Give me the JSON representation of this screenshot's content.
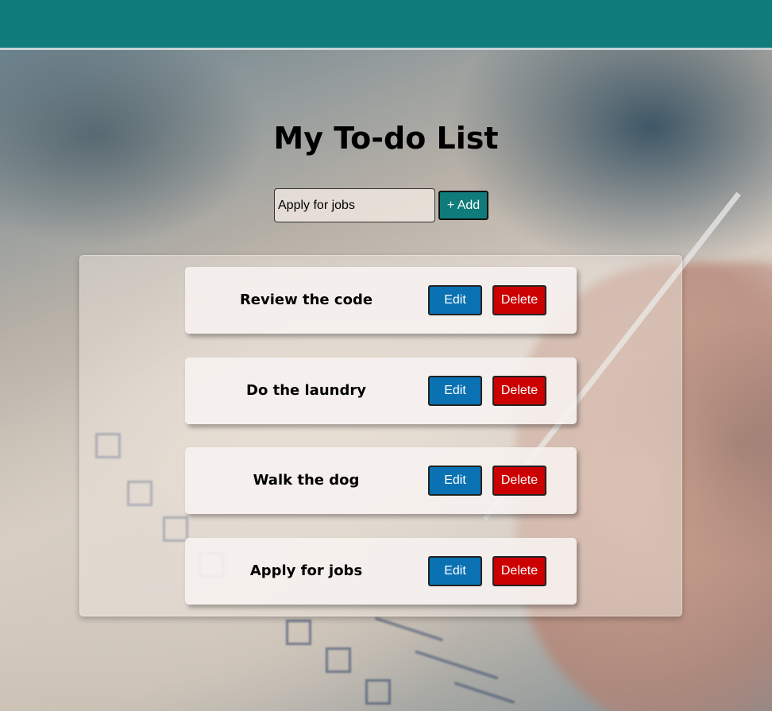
{
  "header": {
    "title": "My To-do List"
  },
  "form": {
    "input_value": "Apply for jobs",
    "add_label": "+ Add"
  },
  "todos": [
    {
      "text": "Review the code",
      "edit_label": "Edit",
      "delete_label": "Delete"
    },
    {
      "text": "Do the laundry",
      "edit_label": "Edit",
      "delete_label": "Delete"
    },
    {
      "text": "Walk the dog",
      "edit_label": "Edit",
      "delete_label": "Delete"
    },
    {
      "text": "Apply for jobs",
      "edit_label": "Edit",
      "delete_label": "Delete"
    }
  ],
  "colors": {
    "topbar": "#0f7b7b",
    "add_button": "#0f7b7b",
    "edit_button": "#0a72b3",
    "delete_button": "#cc0000"
  }
}
